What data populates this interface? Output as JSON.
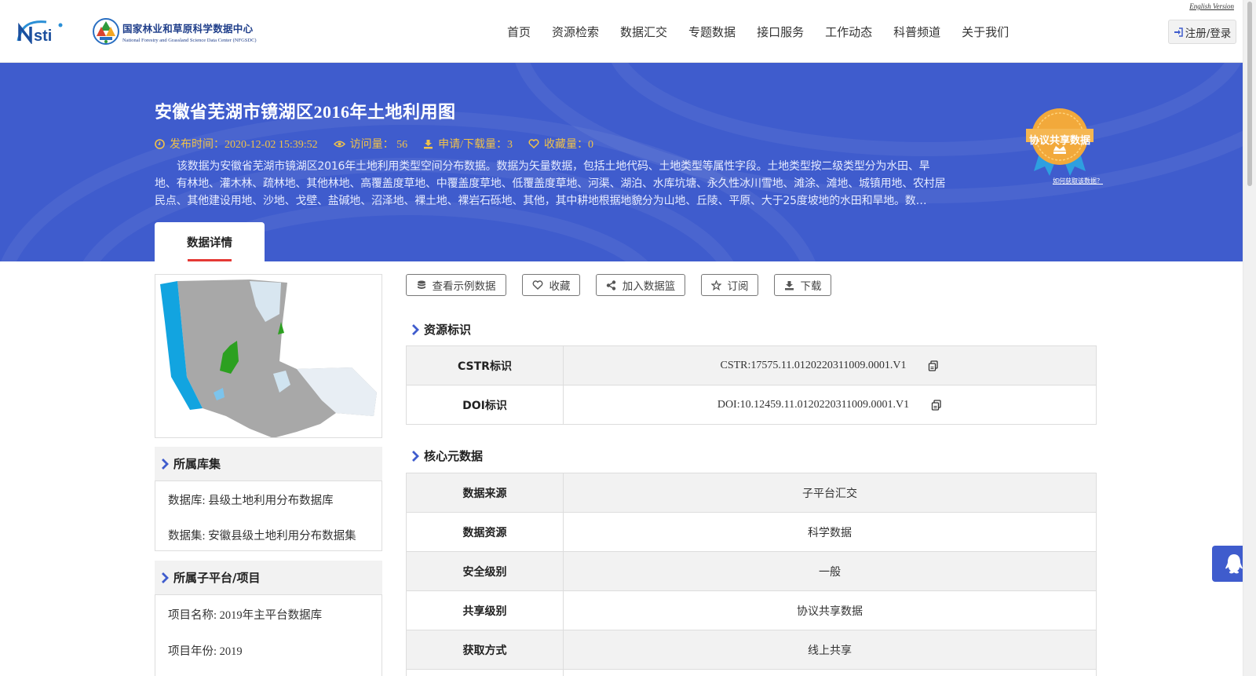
{
  "header": {
    "nsti_logo_text": "Nsti",
    "center_name_cn": "国家林业和草原科学数据中心",
    "center_name_en": "National Forestry and Grassland Science Data Center (NFGSDC)",
    "english_link": "English Version",
    "login_label": "注册/登录",
    "nav": [
      {
        "label": "首页"
      },
      {
        "label": "资源检索"
      },
      {
        "label": "数据汇交"
      },
      {
        "label": "专题数据"
      },
      {
        "label": "接口服务"
      },
      {
        "label": "工作动态"
      },
      {
        "label": "科普频道"
      },
      {
        "label": "关于我们"
      }
    ]
  },
  "banner": {
    "title": "安徽省芜湖市镜湖区2016年土地利用图",
    "publish_time": "发布时间：2020-12-02 15:39:52",
    "views": "访问量： 56",
    "downloads": "申请/下载量：3",
    "favorites": "收藏量：0",
    "description": "该数据为安徽省芜湖市镜湖区2016年土地利用类型空间分布数据。数据为矢量数据，包括土地代码、土地类型等属性字段。土地类型按二级类型分为水田、旱地、有林地、灌木林、疏林地、其他林地、高覆盖度草地、中覆盖度草地、低覆盖度草地、河渠、湖泊、水库坑塘、永久性冰川雪地、滩涂、滩地、城镇用地、农村居民点、其他建设用地、沙地、戈壁、盐碱地、沼泽地、裸土地、裸岩石砾地、其他，其中耕地根据地貌分为山地、丘陵、平原、大于25度坡地的水田和旱地。数…",
    "badge_text": "协议共享数据",
    "how_to_get": "如何获取该数据？",
    "tab_label": "数据详情"
  },
  "colors": {
    "banner_bg": "#3f5ccd",
    "meta_text": "#f0c24a",
    "tab_underline": "#e53935",
    "section_bg": "#f2f2f2"
  },
  "left": {
    "collection_title": "所属库集",
    "database": "数据库: 县级土地利用分布数据库",
    "dataset": "数据集: 安徽县级土地利用分布数据集",
    "project_title": "所属子平台/项目",
    "project_name": "项目名称: 2019年主平台数据库",
    "project_year": "项目年份: 2019"
  },
  "actions": {
    "sample": "查看示例数据",
    "favorite": "收藏",
    "basket": "加入数据篮",
    "subscribe": "订阅",
    "download": "下载"
  },
  "identifiers": {
    "title": "资源标识",
    "rows": [
      {
        "key": "CSTR标识",
        "value": "CSTR:17575.11.0120220311009.0001.V1"
      },
      {
        "key": "DOI标识",
        "value": "DOI:10.12459.11.0120220311009.0001.V1"
      }
    ]
  },
  "core_meta": {
    "title": "核心元数据",
    "rows": [
      {
        "key": "数据来源",
        "value": "子平台汇交"
      },
      {
        "key": "数据资源",
        "value": "科学数据"
      },
      {
        "key": "安全级别",
        "value": "一般"
      },
      {
        "key": "共享级别",
        "value": "协议共享数据"
      },
      {
        "key": "获取方式",
        "value": "线上共享"
      }
    ]
  },
  "icons": {
    "login": "sign-in-icon",
    "publish_time": "clock-icon",
    "views": "eye-icon",
    "downloads": "download-icon",
    "favorites": "heart-icon",
    "section": "chevron-right-icon",
    "copy": "copy-icon",
    "qq": "qq-penguin-icon"
  }
}
